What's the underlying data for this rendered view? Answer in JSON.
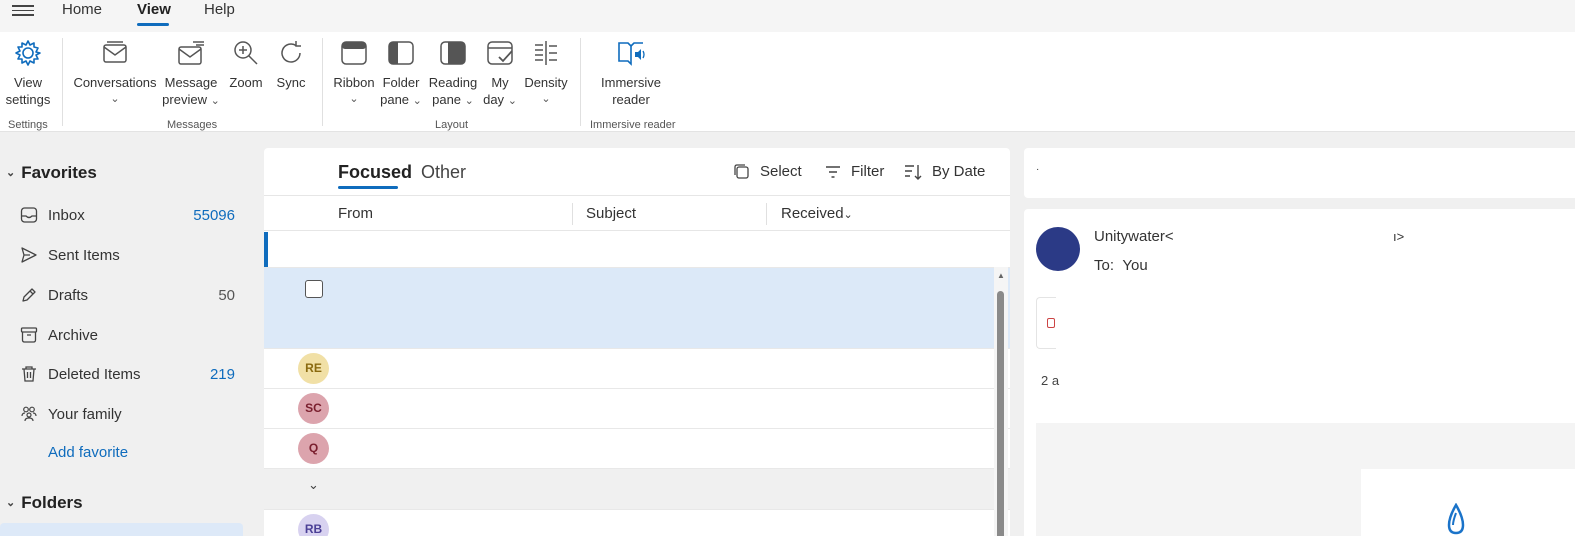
{
  "menu": {
    "tabs": [
      {
        "label": "Home"
      },
      {
        "label": "View"
      },
      {
        "label": "Help"
      }
    ],
    "active_tab": "View"
  },
  "ribbon": {
    "groups": {
      "settings": "Settings",
      "messages": "Messages",
      "layout": "Layout",
      "immersive": "Immersive reader"
    },
    "buttons": {
      "view_settings_1": "View",
      "view_settings_2": "settings",
      "conversations": "Conversations",
      "message_preview_1": "Message",
      "message_preview_2": "preview",
      "zoom": "Zoom",
      "sync": "Sync",
      "ribbon": "Ribbon",
      "folder_pane_1": "Folder",
      "folder_pane_2": "pane",
      "reading_pane_1": "Reading",
      "reading_pane_2": "pane",
      "my_day_1": "My",
      "my_day_2": "day",
      "density": "Density",
      "immersive_1": "Immersive",
      "immersive_2": "reader"
    },
    "accent": "#0f6cbd"
  },
  "nav": {
    "favorites_label": "Favorites",
    "folders_label": "Folders",
    "items": [
      {
        "label": "Inbox",
        "count": "55096"
      },
      {
        "label": "Sent Items",
        "count": ""
      },
      {
        "label": "Drafts",
        "count": "50"
      },
      {
        "label": "Archive",
        "count": ""
      },
      {
        "label": "Deleted Items",
        "count": "219"
      },
      {
        "label": "Your family",
        "count": ""
      }
    ],
    "add_favorite": "Add favorite"
  },
  "message_list": {
    "tabs": {
      "focused": "Focused",
      "other": "Other"
    },
    "toolbar": {
      "select": "Select",
      "filter": "Filter",
      "sort": "By Date"
    },
    "columns": {
      "from": "From",
      "subject": "Subject",
      "received": "Received"
    },
    "avatars": [
      {
        "initials": "RE",
        "bg": "#f1e0a6",
        "fg": "#8a6a10"
      },
      {
        "initials": "SC",
        "bg": "#dca4ad",
        "fg": "#7a1f2e"
      },
      {
        "initials": "Q",
        "bg": "#dca4ad",
        "fg": "#7a1f2e"
      },
      {
        "initials": "RB",
        "bg": "#d8d2f0",
        "fg": "#4b3f96"
      }
    ]
  },
  "reading_pane": {
    "top_dot": "·",
    "sender": "Unitywater<",
    "sender_end": "ı>",
    "to_label": "To:",
    "to_value": "You",
    "attachment_meta": "2 a",
    "avatar_color": "#2b3a86"
  }
}
